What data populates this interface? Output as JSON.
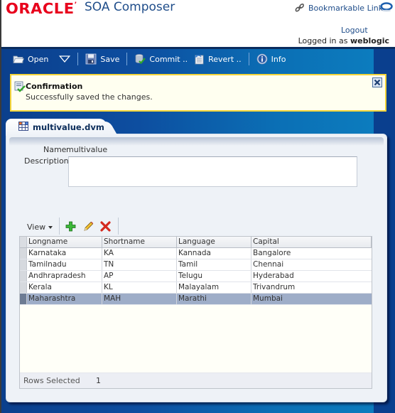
{
  "header": {
    "brand": "ORACLE",
    "app_title": "SOA Composer",
    "bookmark_link": "Bookmarkable Link",
    "logout": "Logout",
    "logged_in_prefix": "Logged in as",
    "username": "weblogic"
  },
  "toolbar": {
    "open": "Open",
    "save": "Save",
    "commit": "Commit ..",
    "revert": "Revert ..",
    "info": "Info"
  },
  "confirmation": {
    "title": "Confirmation",
    "message": "Successfully saved the changes."
  },
  "tab": {
    "label": "multivalue.dvm"
  },
  "form": {
    "name_label": "Name",
    "name_value": "multivalue",
    "description_label": "Description",
    "description_value": ""
  },
  "table": {
    "view_label": "View",
    "columns": [
      "Longname",
      "Shortname",
      "Language",
      "Capital"
    ],
    "rows": [
      [
        "Karnataka",
        "KA",
        "Kannada",
        "Bangalore"
      ],
      [
        "Tamilnadu",
        "TN",
        "Tamil",
        "Chennai"
      ],
      [
        "Andhrapradesh",
        "AP",
        "Telugu",
        "Hyderabad"
      ],
      [
        "Kerala",
        "KL",
        "Malayalam",
        "Trivandrum"
      ],
      [
        "Maharashtra",
        "MAH",
        "Marathi",
        "Mumbai"
      ]
    ],
    "selected_row_index": 4,
    "rows_selected_label": "Rows Selected",
    "rows_selected_value": "1"
  },
  "colors": {
    "oracle_red": "#e8001c",
    "title_blue": "#1f4d8a",
    "confirm_border": "#f2d43a",
    "selected_row": "#9eadc8"
  }
}
